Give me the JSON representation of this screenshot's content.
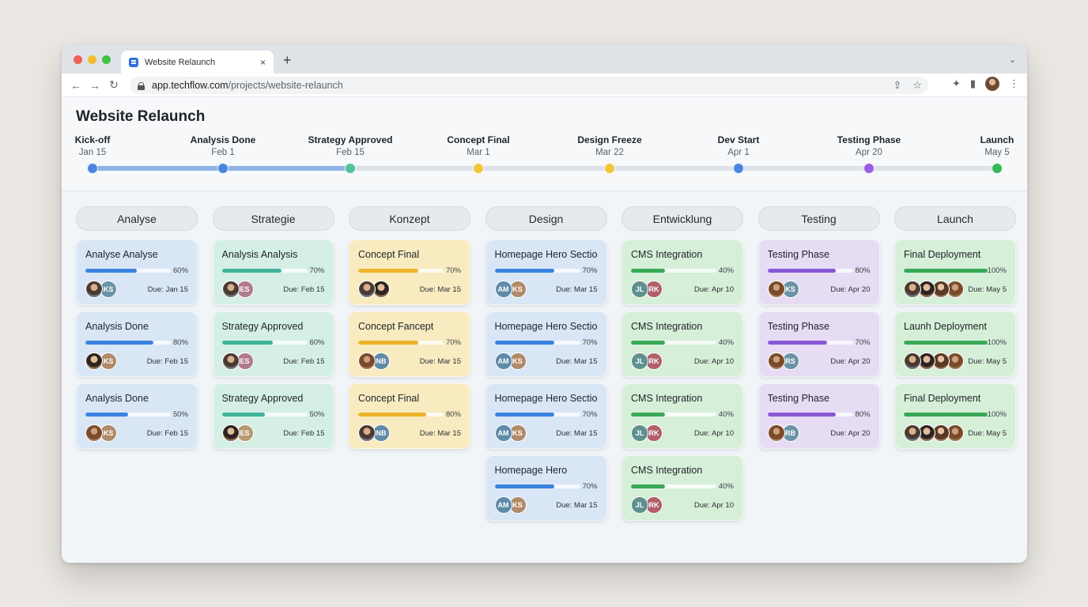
{
  "browser": {
    "tab_title": "Website Relaunch",
    "tab_close": "×",
    "new_tab": "+",
    "tab_menu": "⌄",
    "url_host": "app.techflow.com",
    "url_path": "/projects/website-relaunch",
    "back": "←",
    "forward": "→",
    "reload": "↻",
    "share": "⇪",
    "bookmark": "☆",
    "extensions": "✦",
    "sidepanel": "▮",
    "more": "⋮"
  },
  "page": {
    "title": "Website Relaunch"
  },
  "timeline": {
    "milestones": [
      {
        "label": "Kick-off",
        "date": "Jan 15",
        "color": "#4a86e0"
      },
      {
        "label": "Analysis Done",
        "date": "Feb 1",
        "color": "#4a86e0"
      },
      {
        "label": "Strategy Approved",
        "date": "Feb 15",
        "color": "#52c29a"
      },
      {
        "label": "Concept Final",
        "date": "Mar 1",
        "color": "#f3c637"
      },
      {
        "label": "Design Freeze",
        "date": "Mar 22",
        "color": "#f3c637"
      },
      {
        "label": "Dev Start",
        "date": "Apr 1",
        "color": "#4a86e0"
      },
      {
        "label": "Testing Phase",
        "date": "Apr 20",
        "color": "#9b5de0"
      },
      {
        "label": "Launch",
        "date": "May 5",
        "color": "#34b85a"
      }
    ],
    "completed_through_index": 2
  },
  "columns": [
    {
      "name": "Analyse",
      "theme": "blue",
      "cards": [
        {
          "title": "Analyse Analyse",
          "progress": 60,
          "progress_label": "60%",
          "due": "Due: Jan 15",
          "avatars": [
            {
              "type": "photo-a",
              "initials": ""
            },
            {
              "type": "initials",
              "initials": "KS",
              "color": "#6b93a8"
            }
          ]
        },
        {
          "title": "Analysis Done",
          "progress": 80,
          "progress_label": "80%",
          "due": "Due: Feb 15",
          "avatars": [
            {
              "type": "photo-b",
              "initials": ""
            },
            {
              "type": "initials",
              "initials": "KS",
              "color": "#b08a6a"
            }
          ]
        },
        {
          "title": "Analysis Done",
          "progress": 50,
          "progress_label": "50%",
          "due": "Due: Feb 15",
          "avatars": [
            {
              "type": "photo-c",
              "initials": ""
            },
            {
              "type": "initials",
              "initials": "KS",
              "color": "#b08a6a"
            }
          ]
        }
      ]
    },
    {
      "name": "Strategie",
      "theme": "teal",
      "cards": [
        {
          "title": "Analysis Analysis",
          "progress": 70,
          "progress_label": "70%",
          "due": "Due: Feb 15",
          "avatars": [
            {
              "type": "photo-a",
              "initials": ""
            },
            {
              "type": "initials",
              "initials": "ES",
              "color": "#b07a8a"
            }
          ]
        },
        {
          "title": "Strategy Approved",
          "progress": 60,
          "progress_label": "60%",
          "due": "Due: Feb 15",
          "avatars": [
            {
              "type": "photo-a",
              "initials": ""
            },
            {
              "type": "initials",
              "initials": "ES",
              "color": "#b07a8a"
            }
          ]
        },
        {
          "title": "Strategy Approved",
          "progress": 50,
          "progress_label": "50%",
          "due": "Due: Feb 15",
          "avatars": [
            {
              "type": "photo-b",
              "initials": ""
            },
            {
              "type": "initials",
              "initials": "ES",
              "color": "#b59a70"
            }
          ]
        }
      ]
    },
    {
      "name": "Konzept",
      "theme": "yellow",
      "cards": [
        {
          "title": "Concept Final",
          "progress": 70,
          "progress_label": "70%",
          "due": "Due: Mar 15",
          "avatars": [
            {
              "type": "photo-a",
              "initials": ""
            },
            {
              "type": "photo-b",
              "initials": ""
            }
          ]
        },
        {
          "title": "Concept Fancept",
          "progress": 70,
          "progress_label": "70%",
          "due": "Due: Mar 15",
          "avatars": [
            {
              "type": "photo-c",
              "initials": ""
            },
            {
              "type": "initials",
              "initials": "NB",
              "color": "#5f8aa8"
            }
          ]
        },
        {
          "title": "Concept Final",
          "progress": 80,
          "progress_label": "80%",
          "due": "Due: Mar 15",
          "avatars": [
            {
              "type": "photo-a",
              "initials": ""
            },
            {
              "type": "initials",
              "initials": "NB",
              "color": "#5f8aa8"
            }
          ]
        }
      ]
    },
    {
      "name": "Design",
      "theme": "blue",
      "cards": [
        {
          "title": "Homepage Hero Section",
          "progress": 70,
          "progress_label": "70%",
          "due": "Due: Mar 15",
          "avatars": [
            {
              "type": "initials",
              "initials": "AM",
              "color": "#5f8aa8"
            },
            {
              "type": "initials",
              "initials": "KS",
              "color": "#b08a6a"
            }
          ]
        },
        {
          "title": "Homepage Hero Section",
          "progress": 70,
          "progress_label": "70%",
          "due": "Due: Mar 15",
          "avatars": [
            {
              "type": "initials",
              "initials": "AM",
              "color": "#5f8aa8"
            },
            {
              "type": "initials",
              "initials": "KS",
              "color": "#b08a6a"
            }
          ]
        },
        {
          "title": "Homepage Hero Section",
          "progress": 70,
          "progress_label": "70%",
          "due": "Due: Mar 15",
          "avatars": [
            {
              "type": "initials",
              "initials": "AM",
              "color": "#5f8aa8"
            },
            {
              "type": "initials",
              "initials": "KS",
              "color": "#b08a6a"
            }
          ]
        },
        {
          "title": "Homepage Hero",
          "progress": 70,
          "progress_label": "70%",
          "due": "Due: Mar 15",
          "avatars": [
            {
              "type": "initials",
              "initials": "AM",
              "color": "#5f8aa8"
            },
            {
              "type": "initials",
              "initials": "KS",
              "color": "#b08a6a"
            }
          ]
        }
      ]
    },
    {
      "name": "Entwicklung",
      "theme": "green",
      "cards": [
        {
          "title": "CMS Integration",
          "progress": 40,
          "progress_label": "40%",
          "due": "Due: Apr 10",
          "avatars": [
            {
              "type": "initials",
              "initials": "JL",
              "color": "#5f9090"
            },
            {
              "type": "initials",
              "initials": "RK",
              "color": "#b0606a"
            }
          ]
        },
        {
          "title": "CMS Integration",
          "progress": 40,
          "progress_label": "40%",
          "due": "Due: Apr 10",
          "avatars": [
            {
              "type": "initials",
              "initials": "JL",
              "color": "#5f9090"
            },
            {
              "type": "initials",
              "initials": "RK",
              "color": "#b0606a"
            }
          ]
        },
        {
          "title": "CMS Integration",
          "progress": 40,
          "progress_label": "40%",
          "due": "Due: Apr 10",
          "avatars": [
            {
              "type": "initials",
              "initials": "JL",
              "color": "#5f9090"
            },
            {
              "type": "initials",
              "initials": "RK",
              "color": "#b0606a"
            }
          ]
        },
        {
          "title": "CMS Integration",
          "progress": 40,
          "progress_label": "40%",
          "due": "Due: Apr 10",
          "avatars": [
            {
              "type": "initials",
              "initials": "JL",
              "color": "#5f9090"
            },
            {
              "type": "initials",
              "initials": "RK",
              "color": "#b0606a"
            }
          ]
        }
      ]
    },
    {
      "name": "Testing",
      "theme": "purple",
      "cards": [
        {
          "title": "Testing Phase",
          "progress": 80,
          "progress_label": "80%",
          "due": "Due: Apr 20",
          "avatars": [
            {
              "type": "photo-c",
              "initials": ""
            },
            {
              "type": "initials",
              "initials": "KS",
              "color": "#6b93a8"
            }
          ]
        },
        {
          "title": "Testing Phase",
          "progress": 70,
          "progress_label": "70%",
          "due": "Due: Apr 20",
          "avatars": [
            {
              "type": "photo-c",
              "initials": ""
            },
            {
              "type": "initials",
              "initials": "RS",
              "color": "#6b93a8"
            }
          ]
        },
        {
          "title": "Testing Phase",
          "progress": 80,
          "progress_label": "80%",
          "due": "Due: Apr 20",
          "avatars": [
            {
              "type": "photo-c",
              "initials": ""
            },
            {
              "type": "initials",
              "initials": "RB",
              "color": "#6b93a8"
            }
          ]
        }
      ]
    },
    {
      "name": "Launch",
      "theme": "green",
      "cards": [
        {
          "title": "Final Deployment",
          "progress": 100,
          "progress_label": "100%",
          "due": "Due: May 5",
          "avatars": [
            {
              "type": "photo-a",
              "initials": ""
            },
            {
              "type": "photo-b",
              "initials": ""
            },
            {
              "type": "photo-d",
              "initials": ""
            },
            {
              "type": "photo-c",
              "initials": ""
            }
          ]
        },
        {
          "title": "Launh Deployment",
          "progress": 100,
          "progress_label": "100%",
          "due": "Due: May 5",
          "avatars": [
            {
              "type": "photo-a",
              "initials": ""
            },
            {
              "type": "photo-b",
              "initials": ""
            },
            {
              "type": "photo-d",
              "initials": ""
            },
            {
              "type": "photo-c",
              "initials": ""
            }
          ]
        },
        {
          "title": "Final Deployment",
          "progress": 100,
          "progress_label": "100%",
          "due": "Due: May 5",
          "avatars": [
            {
              "type": "photo-a",
              "initials": ""
            },
            {
              "type": "photo-b",
              "initials": ""
            },
            {
              "type": "photo-d",
              "initials": ""
            },
            {
              "type": "photo-c",
              "initials": ""
            }
          ]
        }
      ]
    }
  ]
}
